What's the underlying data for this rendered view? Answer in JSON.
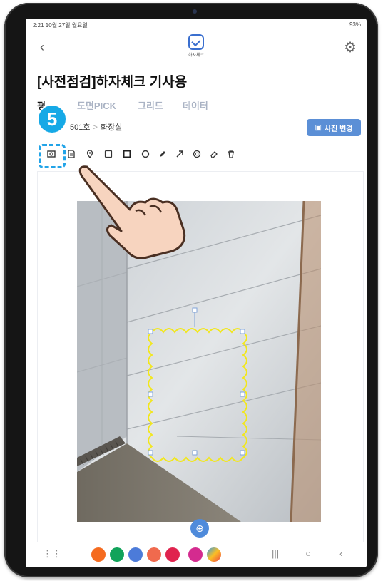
{
  "status_bar": {
    "time": "2:21  10월 27일 월요일",
    "right": "93%"
  },
  "header": {
    "back_icon": "chevron-left-icon",
    "logo_text": "하자체크",
    "settings_icon": "gear-icon"
  },
  "page_title": "[사전점검]하자체크 기사용",
  "tabs": [
    {
      "label": "평"
    },
    {
      "label": "도면PICK"
    },
    {
      "label": "그리드"
    },
    {
      "label": "데이터"
    }
  ],
  "breadcrumb": {
    "unit": "501호",
    "sep": ">",
    "room": "화장실"
  },
  "change_photo_label": "사진 변경",
  "step_badge": "5",
  "toolbar_tools": [
    "capture-icon",
    "document-icon",
    "pin-icon",
    "square-outline-icon",
    "square-bold-icon",
    "circle-icon",
    "pen-icon",
    "arrow-icon",
    "cloud-icon",
    "eraser-icon",
    "trash-icon"
  ],
  "colors": {
    "accent": "#5b8fd6",
    "highlight": "#22a4e8",
    "annotation": "#f2e71c",
    "tab_inactive": "#aab3c4"
  }
}
